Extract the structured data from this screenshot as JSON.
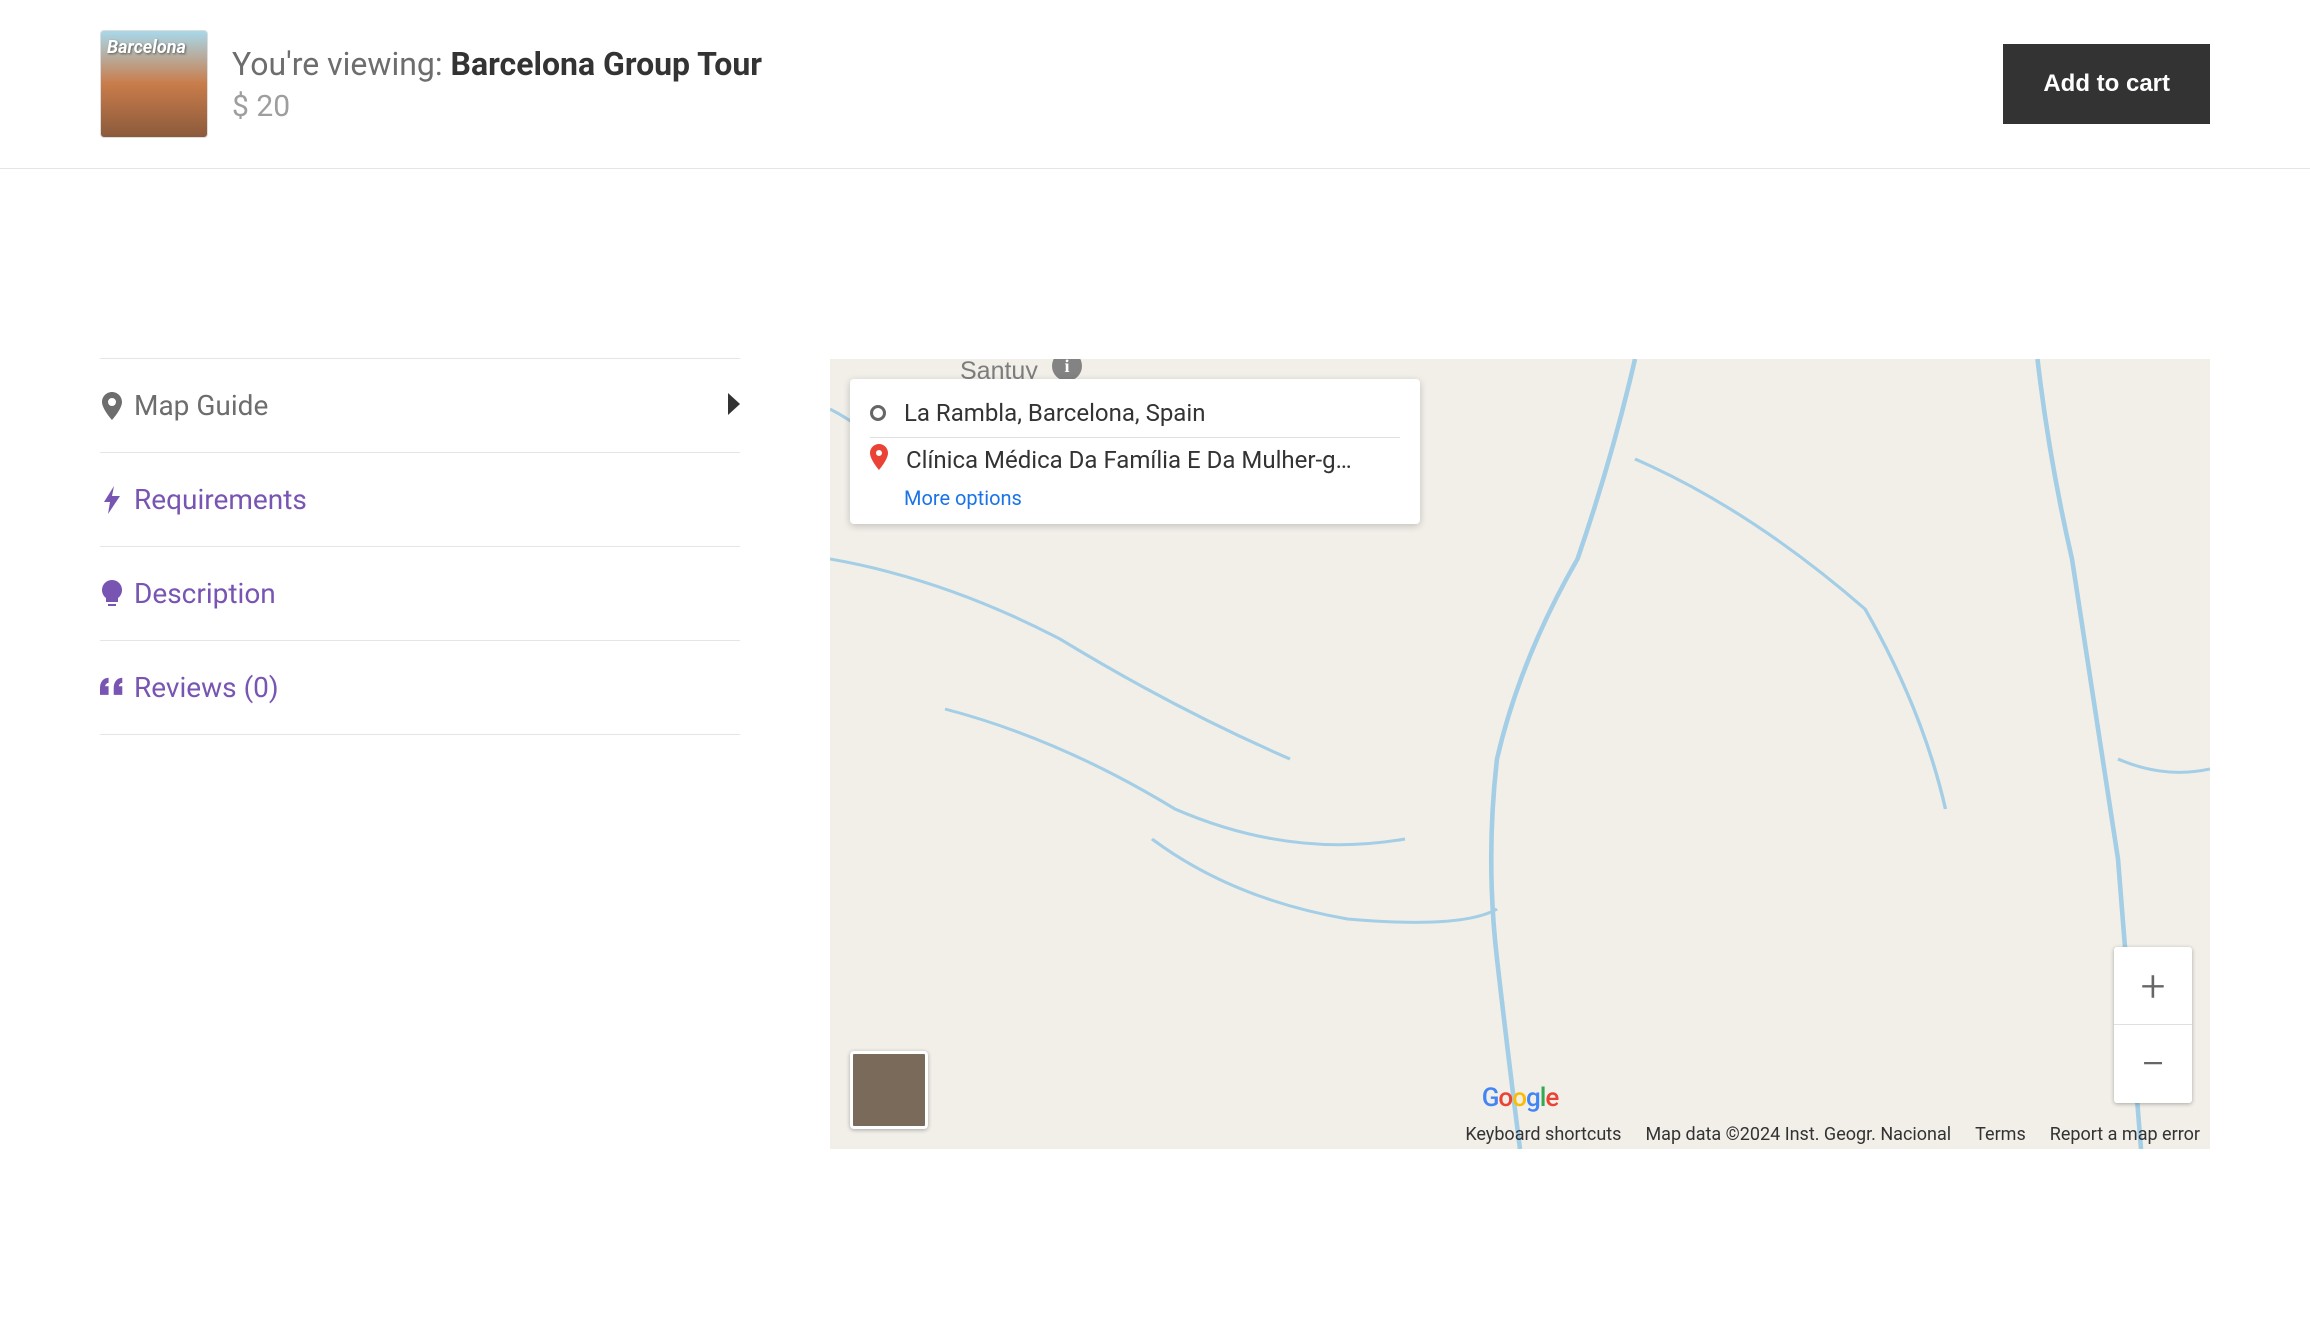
{
  "header": {
    "viewing_prefix": "You're viewing: ",
    "product_title": "Barcelona Group Tour",
    "currency": "$",
    "price": "20",
    "add_to_cart_label": "Add to cart",
    "thumb_overlay_text": "Barcelona"
  },
  "tabs": [
    {
      "label": "Map Guide",
      "active": true
    },
    {
      "label": "Requirements",
      "active": false
    },
    {
      "label": "Description",
      "active": false
    },
    {
      "label": "Reviews (0)",
      "active": false
    }
  ],
  "map": {
    "partial_top_label": "Santuy",
    "directions": {
      "origin": "La Rambla, Barcelona, Spain",
      "destination": "Clínica Médica Da Família E Da Mulher-g…",
      "more_options_label": "More options"
    },
    "google_logo": "Google",
    "footer": {
      "keyboard_shortcuts": "Keyboard shortcuts",
      "map_data": "Map data ©2024 Inst. Geogr. Nacional",
      "terms": "Terms",
      "report": "Report a map error"
    }
  }
}
